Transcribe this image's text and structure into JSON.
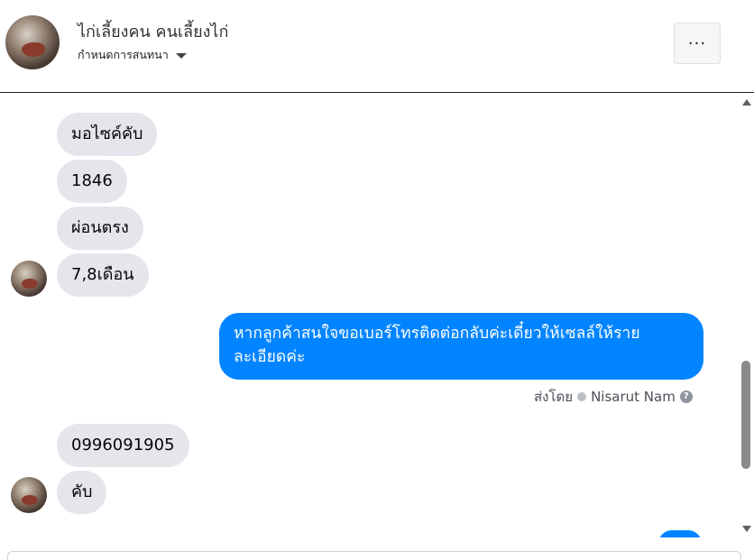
{
  "header": {
    "title": "ไก่เลี้ยงคน คนเลี้ยงไก่",
    "subtitle": "กำหนดการสนทนา",
    "more_label": "···"
  },
  "messages": {
    "incoming_1": [
      "มอไซค์คับ",
      "1846",
      "ผ่อนตรง",
      "7,8เดือน"
    ],
    "outgoing": "หากลูกค้าสนใจขอเบอร์โทรติดต่อกลับค่ะเดี๋ยวให้เซลล์ให้รายละเอียดค่ะ",
    "sent_by_prefix": "ส่งโดย",
    "sent_by_name": "Nisarut Nam",
    "incoming_2": [
      "0996091905",
      "คับ"
    ]
  },
  "icons": {
    "more": "more-horizontal-icon",
    "caret": "caret-down-icon",
    "verified": "check-circle-icon",
    "help": "question-circle-icon"
  },
  "colors": {
    "outgoing_bubble": "#0084ff",
    "incoming_bubble": "#e4e6eb"
  }
}
